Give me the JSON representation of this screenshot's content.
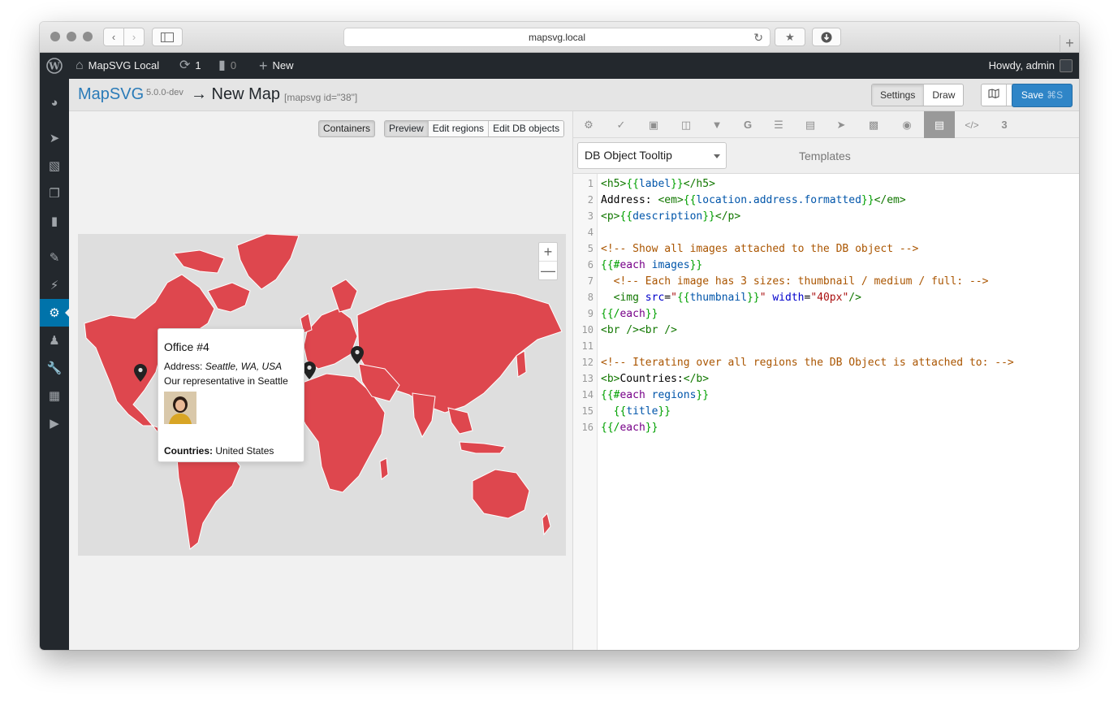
{
  "browser": {
    "url": "mapsvg.local"
  },
  "adminbar": {
    "site_name": "MapSVG Local",
    "updates_count": "1",
    "comments_count": "0",
    "new_label": "New",
    "greeting": "Howdy, admin"
  },
  "header": {
    "brand": "MapSVG",
    "version": "5.0.0-dev",
    "title": "→ New Map",
    "shortcode": "[mapsvg id=\"38\"]",
    "mode_tabs": [
      "Settings",
      "Draw"
    ],
    "active_mode": "Settings",
    "save_label": "Save",
    "save_shortcut": "⌘S"
  },
  "map_panel": {
    "containers_label": "Containers",
    "view_tabs": [
      "Preview",
      "Edit regions",
      "Edit DB objects"
    ],
    "active_view": "Preview",
    "zoom_in": "+",
    "zoom_out": "—",
    "region_color": "#de474e",
    "tooltip": {
      "title": "Office #4",
      "address_label": "Address:",
      "address_value": "Seattle, WA, USA",
      "description": "Our representative in Seattle",
      "countries_label": "Countries:",
      "countries_value": "United States"
    }
  },
  "editor": {
    "toolbar_icons": [
      "gear-icon",
      "brush-icon",
      "layout-icon",
      "database-icon",
      "filter-icon",
      "google-icon",
      "list-icon",
      "card-icon",
      "pointer-icon",
      "image-icon",
      "toggle-icon",
      "template-icon",
      "code-icon",
      "css-icon"
    ],
    "active_tool": "template-icon",
    "template_select": "DB Object Tooltip",
    "section_label": "Templates",
    "line_numbers": [
      "1",
      "2",
      "3",
      "4",
      "5",
      "6",
      "7",
      "8",
      "9",
      "10",
      "11",
      "12",
      "13",
      "14",
      "15",
      "16"
    ],
    "lines": [
      "<h5>{{label}}</h5>",
      "Address: <em>{{location.address.formatted}}</em>",
      "<p>{{description}}</p>",
      "",
      "<!-- Show all images attached to the DB object -->",
      "{{#each images}}",
      "  <!-- Each image has 3 sizes: thumbnail / medium / full: -->",
      "  <img src=\"{{thumbnail}}\" width=\"40px\"/>",
      "{{/each}}",
      "<br /><br />",
      "",
      "<!-- Iterating over all regions the DB Object is attached to: -->",
      "<b>Countries:</b>",
      "{{#each regions}}",
      "  {{title}}",
      "{{/each}}"
    ]
  }
}
